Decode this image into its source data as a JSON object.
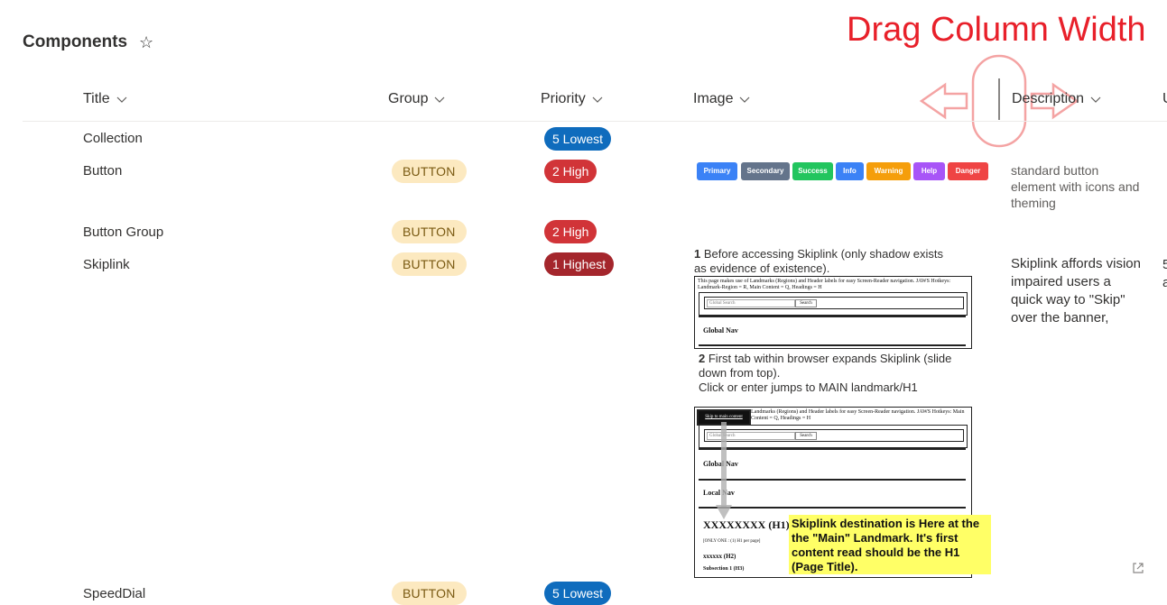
{
  "page": {
    "title": "Components"
  },
  "annotation": {
    "caption": "Drag Column Width"
  },
  "columns": [
    "Title",
    "Group",
    "Priority",
    "Image",
    "Description",
    "U"
  ],
  "rows": [
    {
      "title": "Collection",
      "group": "",
      "priority": "5 Lowest",
      "priority_color": "#0f6cbd",
      "description": ""
    },
    {
      "title": "Button",
      "group": "BUTTON",
      "priority": "2 High",
      "priority_color": "#d13438",
      "description": "standard button element with icons and theming"
    },
    {
      "title": "Button Group",
      "group": "BUTTON",
      "priority": "2 High",
      "priority_color": "#d13438",
      "description": ""
    },
    {
      "title": "Skiplink",
      "group": "BUTTON",
      "priority": "1 Highest",
      "priority_color": "#a4262c",
      "description": "Skiplink affords vision impaired users a quick way to \"Skip\" over the banner, global & local",
      "extra": "5",
      "extra2": "a"
    },
    {
      "title": "SpeedDial",
      "group": "BUTTON",
      "priority": "5 Lowest",
      "priority_color": "#0f6cbd",
      "description": ""
    }
  ],
  "button_preview": [
    {
      "label": "Primary",
      "color": "#3b82f6"
    },
    {
      "label": "Secondary",
      "color": "#64748b"
    },
    {
      "label": "Success",
      "color": "#22c55e"
    },
    {
      "label": "Info",
      "color": "#3b82f6"
    },
    {
      "label": "Warning",
      "color": "#f59e0b"
    },
    {
      "label": "Help",
      "color": "#a855f7"
    },
    {
      "label": "Danger",
      "color": "#ef4444"
    }
  ],
  "skiplink_image": {
    "step1_num": "1",
    "step1": "Before accessing Skiplink (only shadow exists",
    "step1b": "as evidence of existence).",
    "shot1_header": "This page makes use of Landmarks (Regions) and Header labels for easy Screen-Reader navigation. JAWS Hotkeys: Landmark-Region = R, Main Content = Q, Headings = H",
    "search_placeholder": "Global Search",
    "search_button": "Search",
    "global_nav": "Global Nav",
    "step2_num": "2",
    "step2": "First tab within browser expands Skiplink (slide",
    "step2b": "down from top).",
    "step2c": "Click or enter jumps to MAIN landmark/H1",
    "skip_button": "Skip to main content",
    "shot2_header": "Landmarks (Regions) and Header labels for easy Screen-Reader navigation. JAWS Hotkeys: Main Content = Q, Headings = H",
    "local_nav": "Local Nav",
    "h1": "XXXXXXXX (H1)",
    "only_one": "[ONLY ONE : (1) H1 per page]",
    "h2": "xxxxxx (H2)",
    "h3": "Subsection 1 (H3)",
    "callout": "Skiplink destination is Here at the the \"Main\" Landmark.  It's first content read should be the H1 (Page Title)."
  }
}
